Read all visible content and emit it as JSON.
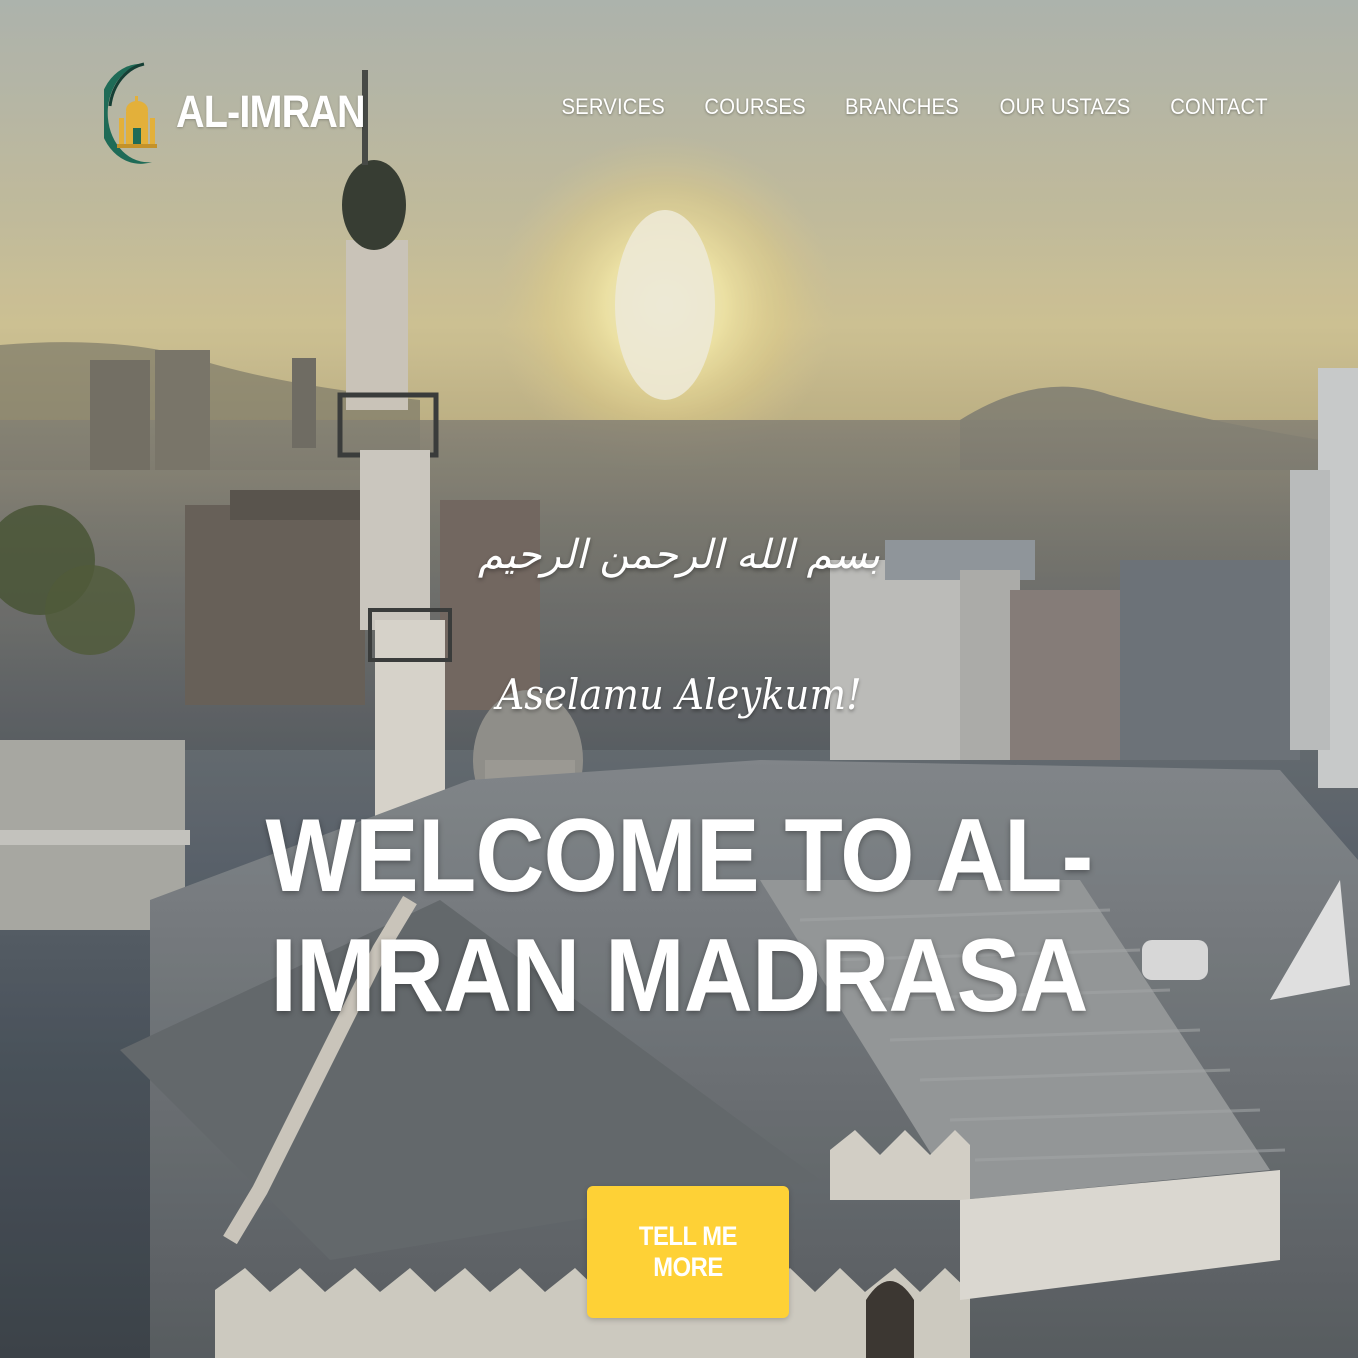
{
  "header": {
    "brand_name": "AL-IMRAN",
    "logo_icon": "mosque-crescent-icon",
    "nav": [
      {
        "label": "SERVICES"
      },
      {
        "label": "COURSES"
      },
      {
        "label": "BRANCHES"
      },
      {
        "label": "OUR USTAZS"
      },
      {
        "label": "CONTACT"
      }
    ]
  },
  "hero": {
    "bismillah": "بسم الله الرحمن الرحيم",
    "greeting": "Aselamu Aleykum!",
    "headline": "WELCOME TO AL-IMRAN MADRASA",
    "cta_label": "TELL ME MORE"
  },
  "colors": {
    "accent": "#fed136",
    "text": "#ffffff",
    "logo_green": "#1f6b57",
    "logo_gold": "#e3b03a"
  }
}
